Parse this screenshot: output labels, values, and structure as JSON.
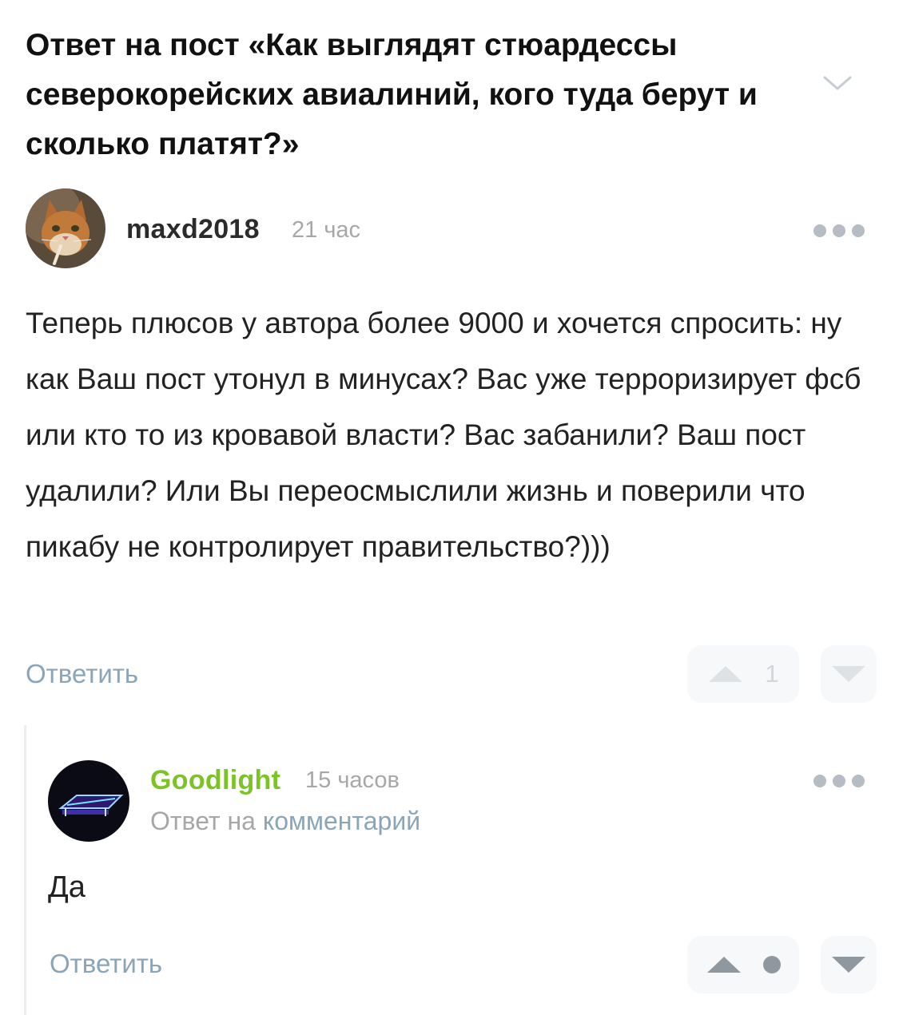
{
  "post": {
    "title": "Ответ на пост «Как выглядят стюардессы северокорейских авиалиний, кого туда берут и сколько платят?»"
  },
  "comment": {
    "author": "maxd2018",
    "time": "21 час",
    "avatar_icon": "cat-avatar",
    "body": "Теперь плюсов у автора более 9000 и хочется спросить: ну как Ваш пост утонул в минусах? Вас уже терроризирует фсб или кто то из кровавой власти? Вас забанили? Ваш пост удалили? Или Вы переосмыслили жизнь и поверили что пикабу не контролирует правительство?)))",
    "reply_label": "Ответить",
    "rating": "1"
  },
  "reply": {
    "author": "Goodlight",
    "time": "15 часов",
    "avatar_icon": "neon-sign-avatar",
    "reply_prefix": "Ответ на",
    "reply_target": "комментарий",
    "body": "Да",
    "reply_label": "Ответить"
  },
  "colors": {
    "accent_link": "#8aa5b8",
    "reply_author": "#7bc327",
    "muted": "#a7a7a7",
    "vote_bg": "#f7f8f9"
  }
}
